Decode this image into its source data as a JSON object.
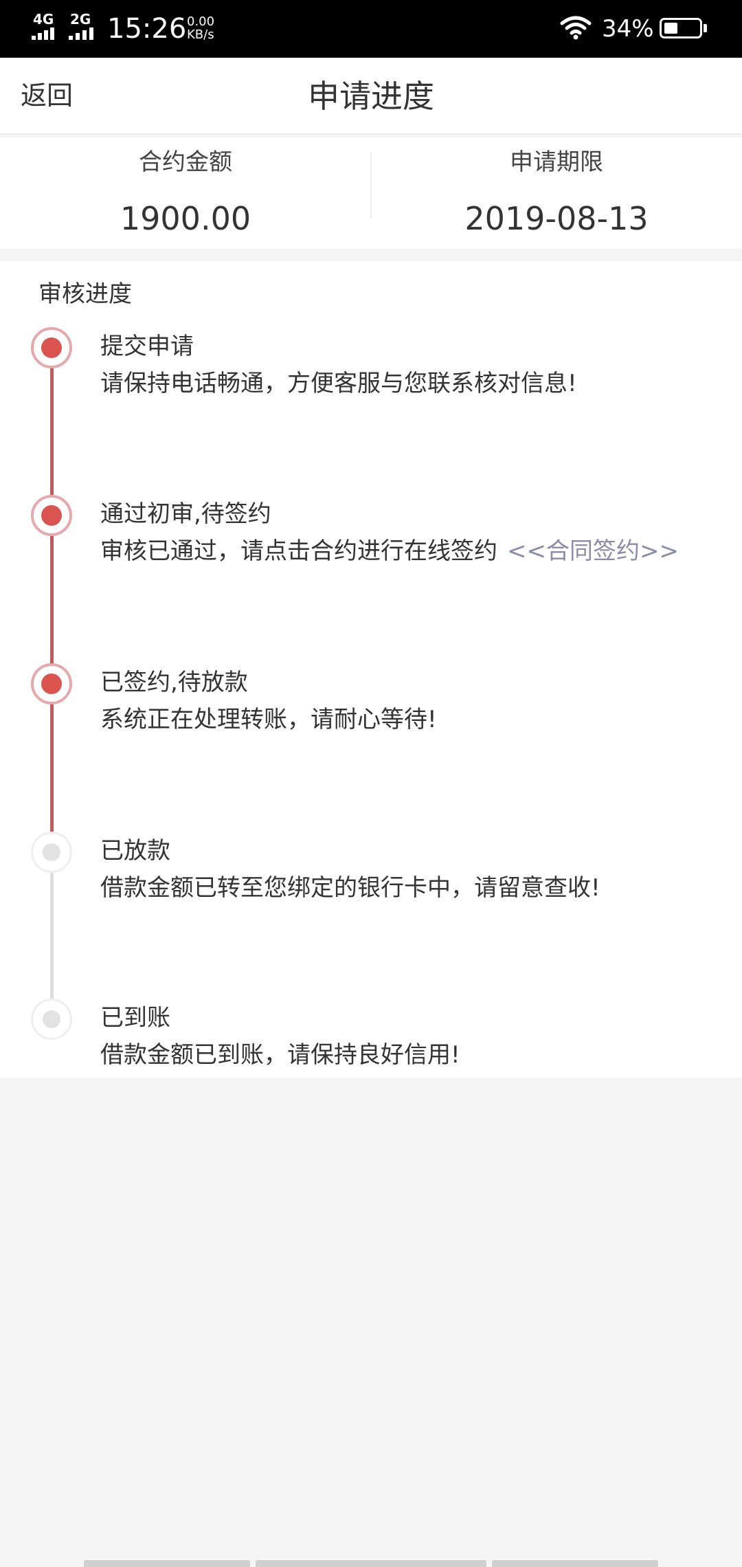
{
  "status_bar": {
    "network_1": "4G",
    "network_2": "2G",
    "time": "15:26",
    "speed_value": "0.00",
    "speed_unit": "KB/s",
    "wifi_icon": "wifi-icon",
    "battery_percent": "34%",
    "battery_level": 0.34
  },
  "header": {
    "back_label": "返回",
    "title": "申请进度"
  },
  "summary": {
    "amount_label": "合约金额",
    "amount_value": "1900.00",
    "term_label": "申请期限",
    "term_value": "2019-08-13"
  },
  "progress": {
    "title": "审核进度",
    "colors": {
      "active": "#d9534f",
      "active_ring": "#e5a8ab",
      "inactive": "#e2e2e2",
      "link": "#8a8aaa"
    },
    "steps": [
      {
        "title": "提交申请",
        "desc": "请保持电话畅通，方便客服与您联系核对信息!",
        "state": "done"
      },
      {
        "title": "通过初审,待签约",
        "desc": "审核已通过，请点击合约进行在线签约",
        "link": "<<合同签约>>",
        "state": "done"
      },
      {
        "title": "已签约,待放款",
        "desc": "系统正在处理转账，请耐心等待!",
        "state": "done"
      },
      {
        "title": "已放款",
        "desc": "借款金额已转至您绑定的银行卡中，请留意查收!",
        "state": "pending"
      },
      {
        "title": "已到账",
        "desc": "借款金额已到账，请保持良好信用!",
        "state": "pending"
      }
    ]
  }
}
